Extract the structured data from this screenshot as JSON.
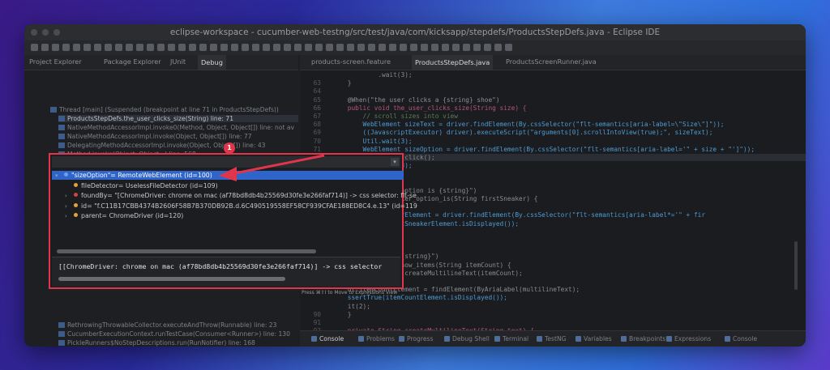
{
  "window": {
    "title": "eclipse-workspace - cucumber-web-testng/src/test/java/com/kicksapp/stepdefs/ProductsStepDefs.java - Eclipse IDE"
  },
  "left_tabs": [
    "Project Explorer",
    "Package Explorer",
    "JUnit",
    "Debug"
  ],
  "debug_stack": [
    "Thread [main] (Suspended (breakpoint at line 71 in ProductsStepDefs))",
    "ProductsStepDefs.the_user_clicks_size(String) line: 71",
    "NativeMethodAccessorImpl.invoke0(Method, Object, Object[]) line: not av",
    "NativeMethodAccessorImpl.invoke(Object, Object[]) line: 77",
    "DelegatingMethodAccessorImpl.invoke(Object, Object[]) line: 43",
    "Method.invoke(Object, Object...) line: 568",
    "Invoker.doInvoke(Located, Object, Method, Object[]) line: 66"
  ],
  "debug_stack_lower": [
    "RethrowingThrowableCollector.executeAndThrow(Runnable) line: 23",
    "CucumberExecutionContext.runTestCase(Consumer<Runner>) line: 130",
    "PickleRunners$NoStepDescriptions.run(RunNotifier) line: 168",
    "FeatureRunner.runChild(PickleRunners$PickleRunner, RunNotifier) line: 14",
    "FeatureRunner.runChild(Object, RunNotifier) line: 26"
  ],
  "editor_tabs": [
    "products-screen.feature",
    "ProductsStepDefs.java",
    "ProductsScreenRunner.java"
  ],
  "code_lines": [
    {
      "n": "",
      "t": "            .wait(3);"
    },
    {
      "n": "63",
      "t": "    }"
    },
    {
      "n": "64",
      "t": ""
    },
    {
      "n": "65",
      "t": "    @When(\"the user clicks a {string} shoe\")"
    },
    {
      "n": "66",
      "t": "    public void the_user_clicks_size(String size) {"
    },
    {
      "n": "67",
      "t": "        // scroll sizes into view"
    },
    {
      "n": "68",
      "t": "        WebElement sizeText = driver.findElement(By.cssSelector(\"flt-semantics[aria-label=\\\"Size\\\"]\"));"
    },
    {
      "n": "69",
      "t": "        ((JavascriptExecutor) driver).executeScript(\"arguments[0].scrollIntoView(true);\", sizeText);"
    },
    {
      "n": "70",
      "t": "        Util.wait(3);"
    },
    {
      "n": "71",
      "t": "        WebElement sizeOption = driver.findElement(By.cssSelector(\"flt-semantics[aria-label='\" + size + \"']\"));"
    },
    {
      "n": "72",
      "t": "        sizeOption.click();"
    },
    {
      "n": "73",
      "t": "        Util.wait(3);"
    },
    {
      "n": "",
      "t": ""
    },
    {
      "n": "",
      "t": ""
    },
    {
      "n": "",
      "t": "    first sneaker option is {string}\")"
    },
    {
      "n": "",
      "t": "    the_first_sneaker_option_is(String firstSneaker) {"
    },
    {
      "n": "",
      "t": "    Top(driver);"
    },
    {
      "n": "",
      "t": "    nt firstSneakerElement = driver.findElement(By.cssSelector(\"flt-semantics[aria-label*='\" + fir"
    },
    {
      "n": "",
      "t": "    ssertTrue(firstSneakerElement.isDisplayed());"
    },
    {
      "n": "",
      "t": "    it(6);"
    },
    {
      "n": "",
      "t": ""
    },
    {
      "n": "",
      "t": ""
    },
    {
      "n": "",
      "t": "    result is now {string}\")"
    },
    {
      "n": "",
      "t": "    the_result_is_now_items(String itemCount) {"
    },
    {
      "n": "",
      "t": "    ultilineText = createMultilineText(itemCount);"
    },
    {
      "n": "",
      "t": "    it(5);"
    },
    {
      "n": "",
      "t": "    nt itemCountElement = findElement(ByAriaLabel(multilineText);"
    },
    {
      "n": "",
      "t": "    ssertTrue(itemCountElement.isDisplayed());"
    },
    {
      "n": "",
      "t": "    it(2);"
    },
    {
      "n": "90",
      "t": "    }"
    },
    {
      "n": "91",
      "t": ""
    },
    {
      "n": "92",
      "t": "    private String createMultilineText(String text) {"
    }
  ],
  "bottom_tabs": [
    "Console",
    "Problems",
    "Progress",
    "Debug Shell",
    "Terminal",
    "TestNG",
    "Variables",
    "Breakpoints",
    "Expressions",
    "Console"
  ],
  "popup": {
    "rows": [
      {
        "text": "\"sizeOption\"= RemoteWebElement  (id=100)",
        "arrow": "▾",
        "dot": "#6f9fe6",
        "indent": 0,
        "selected": true
      },
      {
        "text": "fileDetector= UselessFileDetector  (id=109)",
        "arrow": "",
        "dot": "#e0a33a",
        "indent": 1,
        "selected": false
      },
      {
        "text": "foundBy= \"[ChromeDriver: chrome on mac (af78bd8db4b25569d30fe3e266faf714)] -> css selector: flt-se",
        "arrow": "›",
        "dot": "#d04545",
        "indent": 1,
        "selected": false
      },
      {
        "text": "id= \"f.C11B17CBB4374B2606F58B7B370DB92B.d.6C490519558EF58CF939CFAE188ED8C4.e.13\" (id=119",
        "arrow": "›",
        "dot": "#e0a33a",
        "indent": 1,
        "selected": false
      },
      {
        "text": "parent= ChromeDriver  (id=120)",
        "arrow": "›",
        "dot": "#e0a33a",
        "indent": 1,
        "selected": false
      }
    ],
    "detail": "[[ChromeDriver: chrome on mac (af78bd8db4b25569d30fe3e266faf714)] -> css selector",
    "hint": "Press ⌘⇧I to Move to Expressions View"
  },
  "annotation": {
    "badge": "1",
    "color": "#e0354a"
  }
}
